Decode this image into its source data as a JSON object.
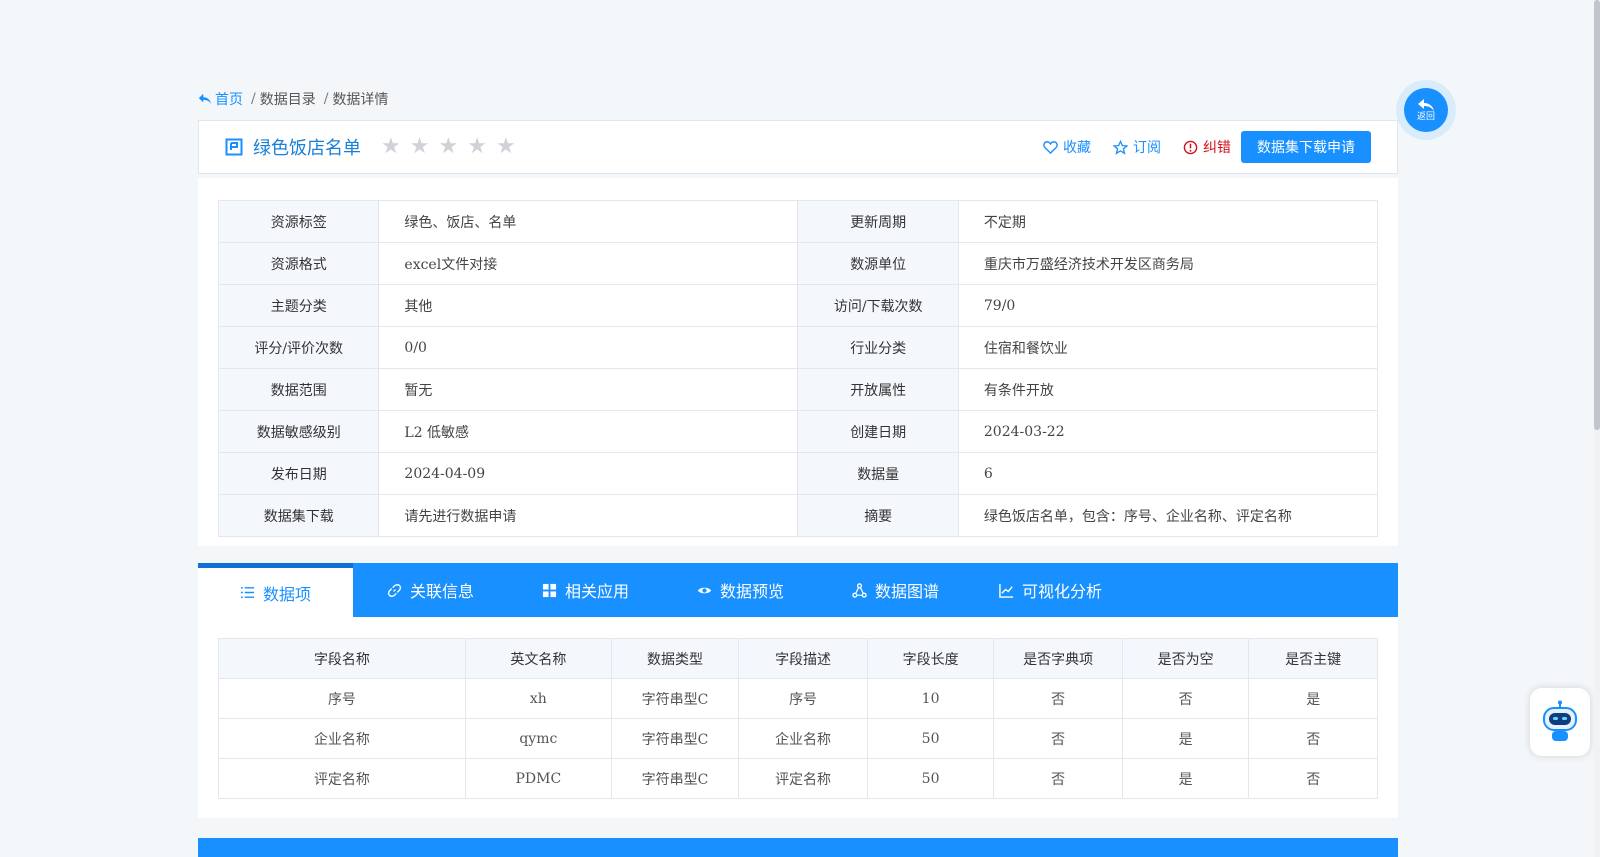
{
  "breadcrumb": {
    "home": "首页",
    "items": [
      "数据目录",
      "数据详情"
    ]
  },
  "header": {
    "title": "绿色饭店名单",
    "rating_stars": 0,
    "favorite_label": "收藏",
    "subscribe_label": "订阅",
    "error_label": "纠错",
    "apply_label": "数据集下载申请"
  },
  "info": [
    [
      "资源标签",
      "绿色、饭店、名单",
      "更新周期",
      "不定期"
    ],
    [
      "资源格式",
      "excel文件对接",
      "数源单位",
      "重庆市万盛经济技术开发区商务局"
    ],
    [
      "主题分类",
      "其他",
      "访问/下载次数",
      "79/0"
    ],
    [
      "评分/评价次数",
      "0/0",
      "行业分类",
      "住宿和餐饮业"
    ],
    [
      "数据范围",
      "暂无",
      "开放属性",
      "有条件开放"
    ],
    [
      "数据敏感级别",
      "L2 低敏感",
      "创建日期",
      "2024-03-22"
    ],
    [
      "发布日期",
      "2024-04-09",
      "数据量",
      "6"
    ],
    [
      "数据集下载",
      "请先进行数据申请",
      "摘要",
      "绿色饭店名单，包含：序号、企业名称、评定名称"
    ]
  ],
  "tabs": [
    "数据项",
    "关联信息",
    "相关应用",
    "数据预览",
    "数据图谱",
    "可视化分析"
  ],
  "fields": {
    "headers": [
      "字段名称",
      "英文名称",
      "数据类型",
      "字段描述",
      "字段长度",
      "是否字典项",
      "是否为空",
      "是否主键"
    ],
    "rows": [
      [
        "序号",
        "xh",
        "字符串型C",
        "序号",
        "10",
        "否",
        "否",
        "是"
      ],
      [
        "企业名称",
        "qymc",
        "字符串型C",
        "企业名称",
        "50",
        "否",
        "是",
        "否"
      ],
      [
        "评定名称",
        "PDMC",
        "字符串型C",
        "评定名称",
        "50",
        "否",
        "是",
        "否"
      ]
    ]
  },
  "back_label": "返回",
  "colors": {
    "primary": "#1890ff",
    "error": "#d4101a"
  }
}
